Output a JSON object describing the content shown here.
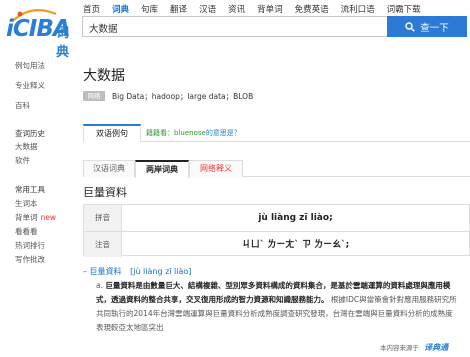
{
  "header": {
    "logo_text": "iCIBA",
    "logo_cn": "词典",
    "nav": [
      {
        "label": "首页",
        "active": false
      },
      {
        "label": "词典",
        "active": true
      },
      {
        "label": "句库",
        "active": false
      },
      {
        "label": "翻译",
        "active": false
      },
      {
        "label": "汉语",
        "active": false
      },
      {
        "label": "资讯",
        "active": false
      },
      {
        "label": "背单词",
        "active": false
      },
      {
        "label": "免费英语",
        "active": false
      },
      {
        "label": "流利口语",
        "active": false
      },
      {
        "label": "词霸下载",
        "active": false
      }
    ],
    "search_value": "大数据",
    "search_button": "查一下"
  },
  "sidebar": {
    "items": [
      {
        "label": "例句用法",
        "head": false
      },
      {
        "label": "专业释义",
        "head": false
      },
      {
        "label": "百科",
        "head": false
      },
      {
        "label": "查词历史",
        "head": true
      },
      {
        "label": "大数据",
        "head": false
      },
      {
        "label": "软件",
        "head": false
      },
      {
        "label": "常用工具",
        "head": true
      },
      {
        "label": "生词本",
        "head": false
      },
      {
        "label": "背单词",
        "head": false,
        "badge": "new"
      },
      {
        "label": "看看看",
        "head": false
      },
      {
        "label": "热词排行",
        "head": false
      },
      {
        "label": "写作批改",
        "head": false
      }
    ]
  },
  "word": {
    "title": "大数据",
    "pos": "网络",
    "definition": "Big Data；hadoop；large data；BLOB"
  },
  "example_tab": {
    "label": "双语例句",
    "ticker_prefix": "籍籍看：bluenose",
    "ticker_suffix": "的意思是？"
  },
  "tabs": [
    {
      "label": "汉语词典",
      "active": false,
      "red": false
    },
    {
      "label": "两岸词典",
      "active": true,
      "red": false
    },
    {
      "label": "网络释义",
      "active": false,
      "red": true
    }
  ],
  "cross_strait": {
    "title": "巨量資料",
    "pinyin_label": "拼音",
    "pinyin": "jù liàng zī liào;",
    "zhuyin_label": "注音",
    "zhuyin": "ㄐㄩˋ ㄌㄧㄤˋ ㄗ ㄌㄧㄠˋ;",
    "sub_title": "巨量資料",
    "sub_pinyin": "[jù liàng zī liào]",
    "sense_marker": "a.",
    "sense_bold": "巨量資料是由數量巨大、結構複雜、型別眾多資料構成的資料集合，是基於雲端運算的資料處理與應用模式，透過資料的整合共享，交叉復用形成的智力資源和知識服務能力。",
    "sense_rest": "根據IDC與當策會針對應用服務研究所共同執行的2014年台灣雲端運算與巨量資料分析成熟度調查研究發現，台灣在雲端與巨量資料分析的成熟度表現較亞太地區突出"
  },
  "footer": {
    "source": "本内容来源于",
    "brand": "译典通"
  },
  "colors": {
    "brand_blue": "#2b7bd6",
    "link_blue": "#1a6fc9",
    "ticker_green": "#2b9b2b",
    "new_red": "#e33333"
  }
}
